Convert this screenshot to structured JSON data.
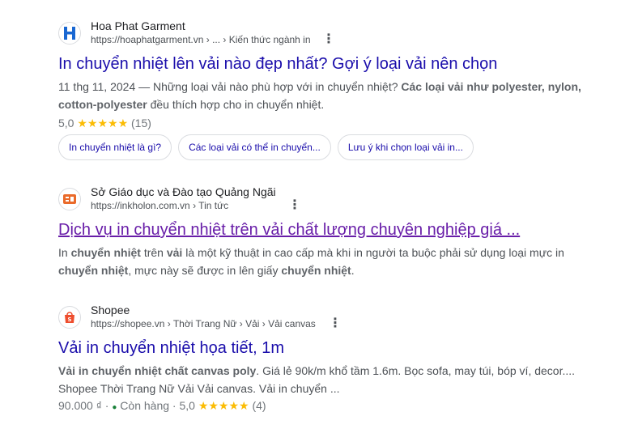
{
  "results": [
    {
      "site_name": "Hoa Phat Garment",
      "url": "https://hoaphatgarment.vn › ... › Kiến thức ngành in",
      "title": "In chuyển nhiệt lên vải nào đẹp nhất? Gợi ý loại vải nên chọn",
      "date": "11 thg 11, 2024",
      "snippet_line1_pre": " — Những loại vải nào phù hợp với in chuyển nhiệt? ",
      "snippet_line1_bold": "Các loại vải như polyester, nylon,",
      "snippet_line2_bold": "cotton-polyester",
      "snippet_line2_post": " đều thích hợp cho in chuyển nhiệt.",
      "rating_value": "5,0",
      "stars": "★★★★★",
      "rating_count": "(15)",
      "chips": [
        "In chuyển nhiệt là gì?",
        "Các loại vải có thể in chuyển...",
        "Lưu ý khi chọn loại vải in..."
      ]
    },
    {
      "site_name": "Sở Giáo dục và Đào tạo Quảng Ngãi",
      "url": "https://inkholon.com.vn › Tin tức",
      "title": "Dịch vụ in chuyển nhiệt trên vải chất lượng chuyên nghiệp giá ...",
      "s1": "In ",
      "s2": "chuyển nhiệt",
      "s3": " trên ",
      "s4": "vải",
      "s5": " là một kỹ thuật in cao cấp mà khi in người ta buộc phải sử dụng loại mực in",
      "s6": "chuyển nhiệt",
      "s7": ", mực này sẽ được in lên giấy ",
      "s8": "chuyển nhiệt",
      "s9": "."
    },
    {
      "site_name": "Shopee",
      "url": "https://shopee.vn › Thời Trang Nữ › Vải › Vải canvas",
      "title": "Vải in chuyển nhiệt họa tiết, 1m",
      "snippet_bold": "Vải in chuyển nhiệt chất canvas poly",
      "snippet_rest": ". Giá lẻ 90k/m khổ tầm 1.6m. Bọc sofa, may túi, bóp ví, decor....",
      "snippet_line2": "Shopee Thời Trang Nữ Vải Vải canvas. Vải in chuyển ...",
      "price": "90.000 ₫",
      "sep": " · ",
      "stock": "Còn hàng",
      "rating_value": "5,0",
      "stars": "★★★★★",
      "rating_count": "(4)"
    }
  ],
  "icons": {
    "more": "⋮",
    "dot": "●"
  },
  "colors": {
    "link": "#1a0dab",
    "visited": "#681da8",
    "star": "#fbbc04",
    "in_stock": "#188038"
  }
}
